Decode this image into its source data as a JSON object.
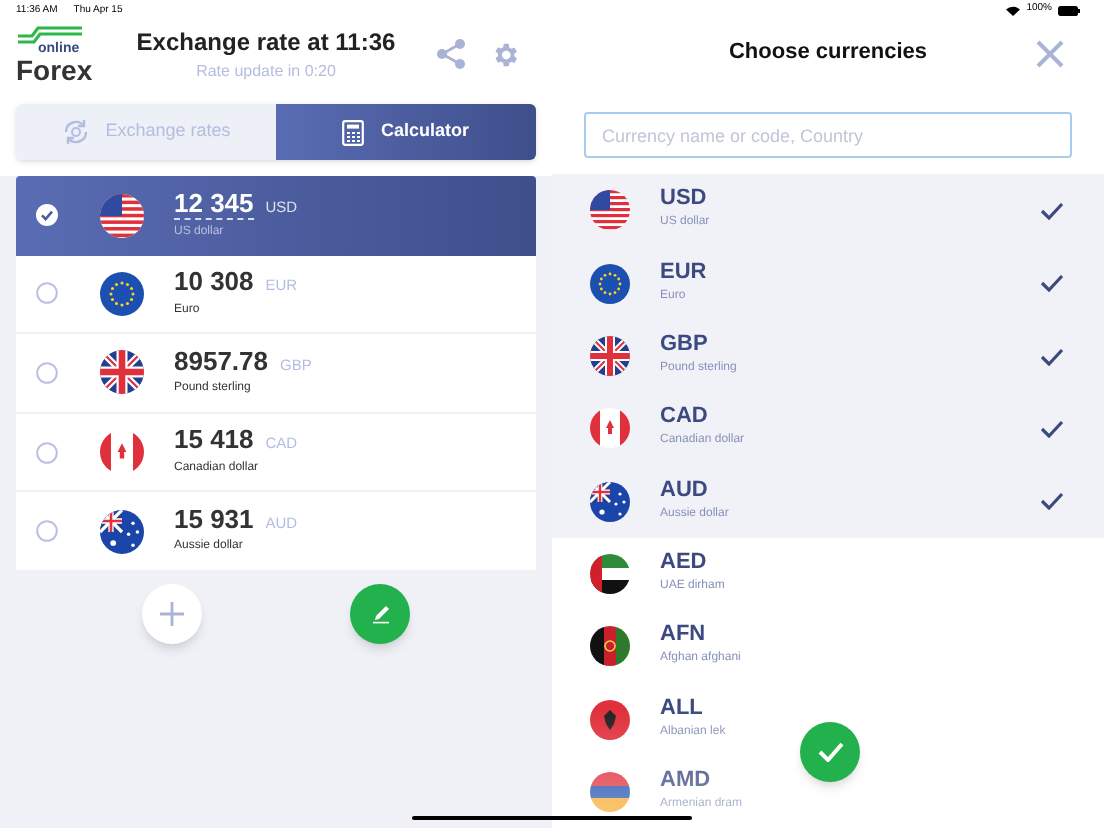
{
  "status_bar": {
    "time": "11:36 AM",
    "date": "Thu Apr 15",
    "battery": "100%"
  },
  "header": {
    "logo_top": "online",
    "logo_bottom": "Forex",
    "title": "Exchange rate at 11:36",
    "subtitle": "Rate update in 0:20"
  },
  "tabs": [
    {
      "label": "Exchange rates",
      "selected": false
    },
    {
      "label": "Calculator",
      "selected": true
    }
  ],
  "amounts": [
    {
      "amount": "12 345",
      "code": "USD",
      "name": "US dollar",
      "selected": true
    },
    {
      "amount": "10 308",
      "code": "EUR",
      "name": "Euro",
      "selected": false
    },
    {
      "amount": "8957.78",
      "code": "GBP",
      "name": "Pound sterling",
      "selected": false
    },
    {
      "amount": "15 418",
      "code": "CAD",
      "name": "Canadian dollar",
      "selected": false
    },
    {
      "amount": "15 931",
      "code": "AUD",
      "name": "Aussie dollar",
      "selected": false
    }
  ],
  "picker": {
    "title": "Choose currencies",
    "search": {
      "placeholder": "Currency name or code, Country"
    },
    "currencies": [
      {
        "code": "USD",
        "name": "US dollar",
        "checked": true
      },
      {
        "code": "EUR",
        "name": "Euro",
        "checked": true
      },
      {
        "code": "GBP",
        "name": "Pound sterling",
        "checked": true
      },
      {
        "code": "CAD",
        "name": "Canadian dollar",
        "checked": true
      },
      {
        "code": "AUD",
        "name": "Aussie dollar",
        "checked": true
      },
      {
        "code": "AED",
        "name": "UAE dirham",
        "checked": false
      },
      {
        "code": "AFN",
        "name": "Afghan afghani",
        "checked": false
      },
      {
        "code": "ALL",
        "name": "Albanian lek",
        "checked": false
      },
      {
        "code": "AMD",
        "name": "Armenian dram",
        "checked": false
      }
    ]
  }
}
